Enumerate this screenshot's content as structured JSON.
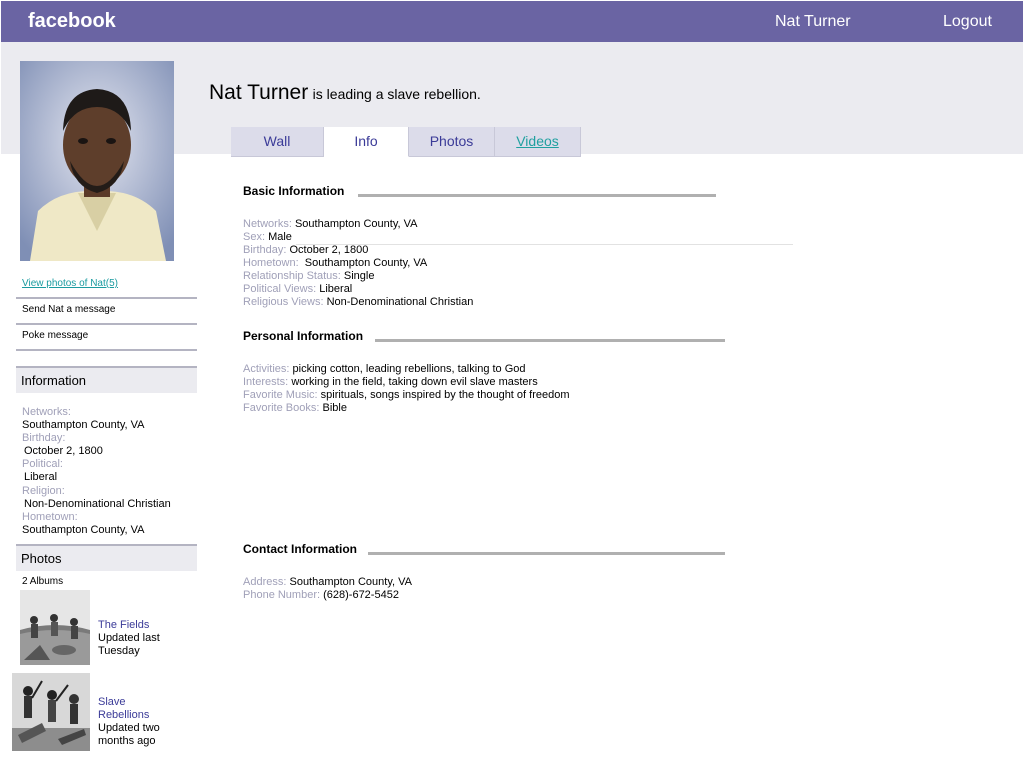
{
  "topbar": {
    "brand": "facebook",
    "user": "Nat Turner",
    "logout": "Logout"
  },
  "profile": {
    "name": "Nat Turner",
    "status": "is leading a slave rebellion."
  },
  "tabs": [
    {
      "label": "Wall"
    },
    {
      "label": "Info"
    },
    {
      "label": "Photos"
    },
    {
      "label": "Videos"
    }
  ],
  "sidebar": {
    "view_photos": "View photos of Nat(5)",
    "send_message": "Send Nat a message",
    "poke": "Poke message",
    "information_title": "Information",
    "networks_label": "Networks:",
    "networks_value": "Southampton County, VA",
    "birthday_label": "Birthday:",
    "birthday_value": "October 2, 1800",
    "political_label": "Political:",
    "political_value": "Liberal",
    "religion_label": "Religion:",
    "religion_value": "Non-Denominational Christian",
    "hometown_label": "Hometown:",
    "hometown_value": "Southampton County, VA",
    "photos_title": "Photos",
    "albums_count": "2 Albums",
    "albums": [
      {
        "title": "The Fields",
        "meta1": "Updated last",
        "meta2": "Tuesday"
      },
      {
        "title1": "Slave",
        "title2": "Rebellions",
        "meta1": "Updated two",
        "meta2": "months ago"
      }
    ]
  },
  "basic": {
    "title": "Basic Information",
    "rows": [
      {
        "label": "Networks:",
        "value": "Southampton County, VA"
      },
      {
        "label": "Sex:",
        "value": "Male"
      },
      {
        "label": "Birthday:",
        "value": "October 2, 1800"
      },
      {
        "label": "Hometown:",
        "value": "Southampton County, VA"
      },
      {
        "label": "Relationship Status:",
        "value": "Single"
      },
      {
        "label": "Political Views:",
        "value": "Liberal"
      },
      {
        "label": "Religious Views:",
        "value": "Non-Denominational Christian"
      }
    ]
  },
  "personal": {
    "title": "Personal Information",
    "rows": [
      {
        "label": "Activities:",
        "value": "picking cotton, leading rebellions, talking to God"
      },
      {
        "label": "Interests:",
        "value": "working in the field, taking down evil slave masters"
      },
      {
        "label": "Favorite Music:",
        "value": "spirituals, songs inspired by the thought of freedom"
      },
      {
        "label": "Favorite Books:",
        "value": "Bible"
      }
    ]
  },
  "contact": {
    "title": "Contact Information",
    "rows": [
      {
        "label": "Address:",
        "value": "Southampton County, VA"
      },
      {
        "label": "Phone Number:",
        "value": "(628)-672-5452"
      }
    ]
  },
  "colors": {
    "topbar": "#6a64a3",
    "band": "#ebebf0",
    "link": "#3b3b98",
    "label": "#a0a0b8"
  }
}
